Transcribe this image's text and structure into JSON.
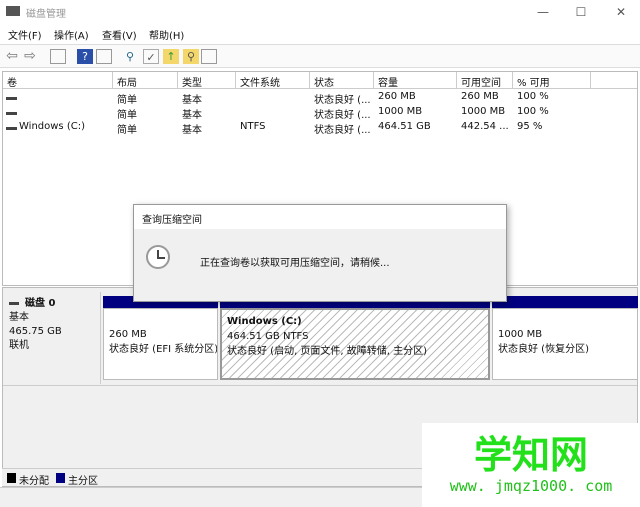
{
  "window": {
    "title": "磁盘管理",
    "minimize": "—",
    "maximize": "☐",
    "close": "✕"
  },
  "menu": [
    "文件(F)",
    "操作(A)",
    "查看(V)",
    "帮助(H)"
  ],
  "toolbar": {
    "back": "⇦",
    "forward": "⇨",
    "icons": [
      "panel-icon",
      "help-icon",
      "panel2-icon",
      "connect-icon",
      "check-icon",
      "folder-up-icon",
      "folder-search-icon",
      "properties-icon"
    ]
  },
  "table": {
    "headers": [
      "卷",
      "布局",
      "类型",
      "文件系统",
      "状态",
      "容量",
      "可用空间",
      "% 可用"
    ],
    "rows": [
      [
        "",
        "简单",
        "基本",
        "",
        "状态良好 (...",
        "260 MB",
        "260 MB",
        "100 %"
      ],
      [
        "",
        "简单",
        "基本",
        "",
        "状态良好 (...",
        "1000 MB",
        "1000 MB",
        "100 %"
      ],
      [
        "Windows (C:)",
        "简单",
        "基本",
        "NTFS",
        "状态良好 (...",
        "464.51 GB",
        "442.54 ...",
        "95 %"
      ]
    ]
  },
  "dialog": {
    "title": "查询压缩空间",
    "message": "正在查询卷以获取可用压缩空间，请稍候..."
  },
  "disk": {
    "name": "磁盘 0",
    "type": "基本",
    "size": "465.75 GB",
    "state": "联机",
    "partitions": [
      {
        "title": "",
        "size": "260 MB",
        "status": "状态良好 (EFI 系统分区)"
      },
      {
        "title": "Windows  (C:)",
        "size": "464.51 GB NTFS",
        "status": "状态良好 (启动, 页面文件, 故障转储, 主分区)"
      },
      {
        "title": "",
        "size": "1000 MB",
        "status": "状态良好 (恢复分区)"
      }
    ]
  },
  "legend": [
    {
      "label": "未分配",
      "color": "#000000"
    },
    {
      "label": "主分区",
      "color": "#000080"
    }
  ],
  "watermark": {
    "name": "学知网",
    "url": "www. jmqz1000. com"
  }
}
